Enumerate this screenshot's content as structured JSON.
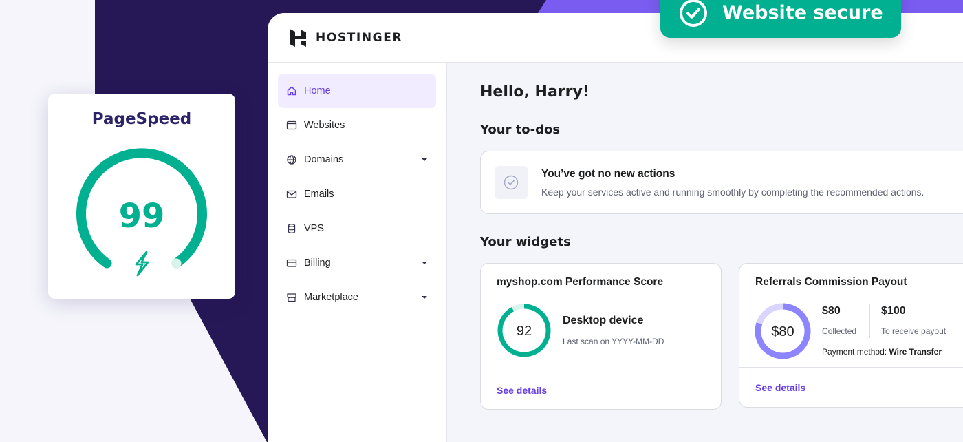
{
  "brand": {
    "name": "HOSTINGER"
  },
  "badge": {
    "text": "Website secure"
  },
  "pagespeed": {
    "title": "PageSpeed",
    "score": "99",
    "score_fraction": 0.99
  },
  "sidebar": {
    "items": [
      {
        "label": "Home",
        "icon": "home-icon",
        "active": true
      },
      {
        "label": "Websites",
        "icon": "browser-icon"
      },
      {
        "label": "Domains",
        "icon": "globe-icon",
        "expandable": true
      },
      {
        "label": "Emails",
        "icon": "mail-icon"
      },
      {
        "label": "VPS",
        "icon": "server-icon"
      },
      {
        "label": "Billing",
        "icon": "card-icon",
        "expandable": true
      },
      {
        "label": "Marketplace",
        "icon": "store-icon",
        "expandable": true
      }
    ]
  },
  "main": {
    "greeting": "Hello, Harry!",
    "todos_heading": "Your to-dos",
    "todo": {
      "title": "You’ve got no new actions",
      "description": "Keep your services active and running smoothly by completing the recommended actions."
    },
    "widgets_heading": "Your widgets",
    "performance": {
      "title": "myshop.com Performance Score",
      "score": "92",
      "device": "Desktop device",
      "last_scan": "Last scan on YYYY-MM-DD",
      "link": "See details"
    },
    "referrals": {
      "title": "Referrals Commission Payout",
      "amount": "$80",
      "collected_value": "$80",
      "collected_label": "Collected",
      "payout_value": "$100",
      "payout_label": "To receive payout",
      "payment_label": "Payment method:",
      "payment_method": "Wire Transfer",
      "link": "See details"
    }
  },
  "colors": {
    "purple_dark": "#261856",
    "accent": "#673de6",
    "green": "#00b090",
    "ring_purple": "#8c85ff"
  }
}
